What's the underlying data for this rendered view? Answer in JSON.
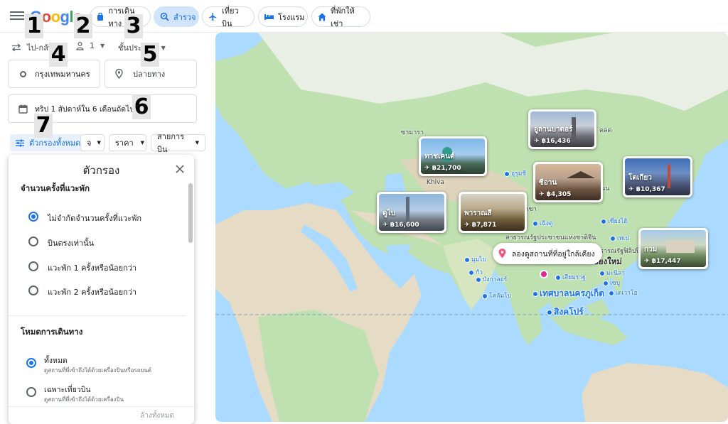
{
  "header": {
    "logo_text": "Google",
    "tabs": [
      {
        "label": "การเดินทาง",
        "icon": "suitcase-icon"
      },
      {
        "label": "สำรวจ",
        "icon": "explore-icon",
        "active": true
      },
      {
        "label": "เที่ยวบิน",
        "icon": "plane-icon"
      },
      {
        "label": "โรงแรม",
        "icon": "bed-icon"
      },
      {
        "label": "ที่พักให้เช่า",
        "icon": "house-icon"
      }
    ]
  },
  "badges": [
    "1",
    "2",
    "3",
    "4",
    "5",
    "6",
    "7"
  ],
  "search": {
    "trip_type": "ไป-กลับ",
    "passengers": "1",
    "cabin_class": "ชั้นประหยัด",
    "origin": "กรุงเทพมหานคร",
    "destination_placeholder": "ปลายทาง",
    "dates": "ทริป 1 สัปดาห์ใน 6 เดือนถัดไป"
  },
  "filters": {
    "all_filters": "ตัวกรองทั้งหมด",
    "stops_chip": "จ",
    "price": "ราคา",
    "airline": "สายการบิน"
  },
  "filter_dialog": {
    "title": "ตัวกรอง",
    "stops_section": "จำนวนครั้งที่แวะพัก",
    "stops_options": [
      {
        "label": "ไม่จำกัดจำนวนครั้งที่แวะพัก",
        "selected": true
      },
      {
        "label": "บินตรงเท่านั้น",
        "selected": false
      },
      {
        "label": "แวะพัก 1 ครั้งหรือน้อยกว่า",
        "selected": false
      },
      {
        "label": "แวะพัก 2 ครั้งหรือน้อยกว่า",
        "selected": false
      }
    ],
    "mode_section": "โหมดการเดินทาง",
    "mode_options": [
      {
        "label": "ทั้งหมด",
        "sub": "ดูสถานที่ที่เข้าถึงได้ด้วยเครื่องบินหรือรถยนต์",
        "selected": true
      },
      {
        "label": "เฉพาะเที่ยวบิน",
        "sub": "ดูสถานที่ที่เข้าถึงได้ด้วยเครื่องบิน",
        "selected": false
      }
    ],
    "clear_all": "ล้างทั้งหมด"
  },
  "map": {
    "nearby_button": "ลองดูสถานที่ที่อยู่ใกล้เคียง",
    "destinations": [
      {
        "name": "ทาชเคนต์",
        "price": "฿21,700"
      },
      {
        "name": "อูลานบาตอร์",
        "price": "฿16,436"
      },
      {
        "name": "ซีอาน",
        "price": "฿4,305"
      },
      {
        "name": "โตเกียว",
        "price": "฿10,367"
      },
      {
        "name": "ดูไบ",
        "price": "฿16,600"
      },
      {
        "name": "พาราณสี",
        "price": "฿7,871"
      },
      {
        "name": "กวม",
        "price": "฿17,447"
      }
    ],
    "labels": {
      "samara": "ซามารา",
      "khiva": "Khiva",
      "urumqi": "อุรุมชี",
      "chengdu": "เฉิงตู",
      "shanghai": "เซี่ยงไฮ้",
      "taipei": "เทเป",
      "mumbai": "มุมไบ",
      "goa": "กัว",
      "bangalore": "บังกาลอร์",
      "colombo": "โคลัมโบ",
      "siem_reap": "เสียมราฐ",
      "phuket": "เทศบาลนครภูเก็ต",
      "singapore": "สิงคโปร์",
      "manila": "มะนิลา",
      "cebu": "เซบู",
      "davao": "เดเวาโอ",
      "chiang_mai": "เชียงใหม่",
      "philippines": "สาธารณรัฐฟิลิปปินส์",
      "china": "สาธารณรัฐประชาชนแห่งชาติจีน",
      "kalk": "คลด",
      "sinn": "ซินน",
      "lhasa": "ลาซา"
    }
  }
}
